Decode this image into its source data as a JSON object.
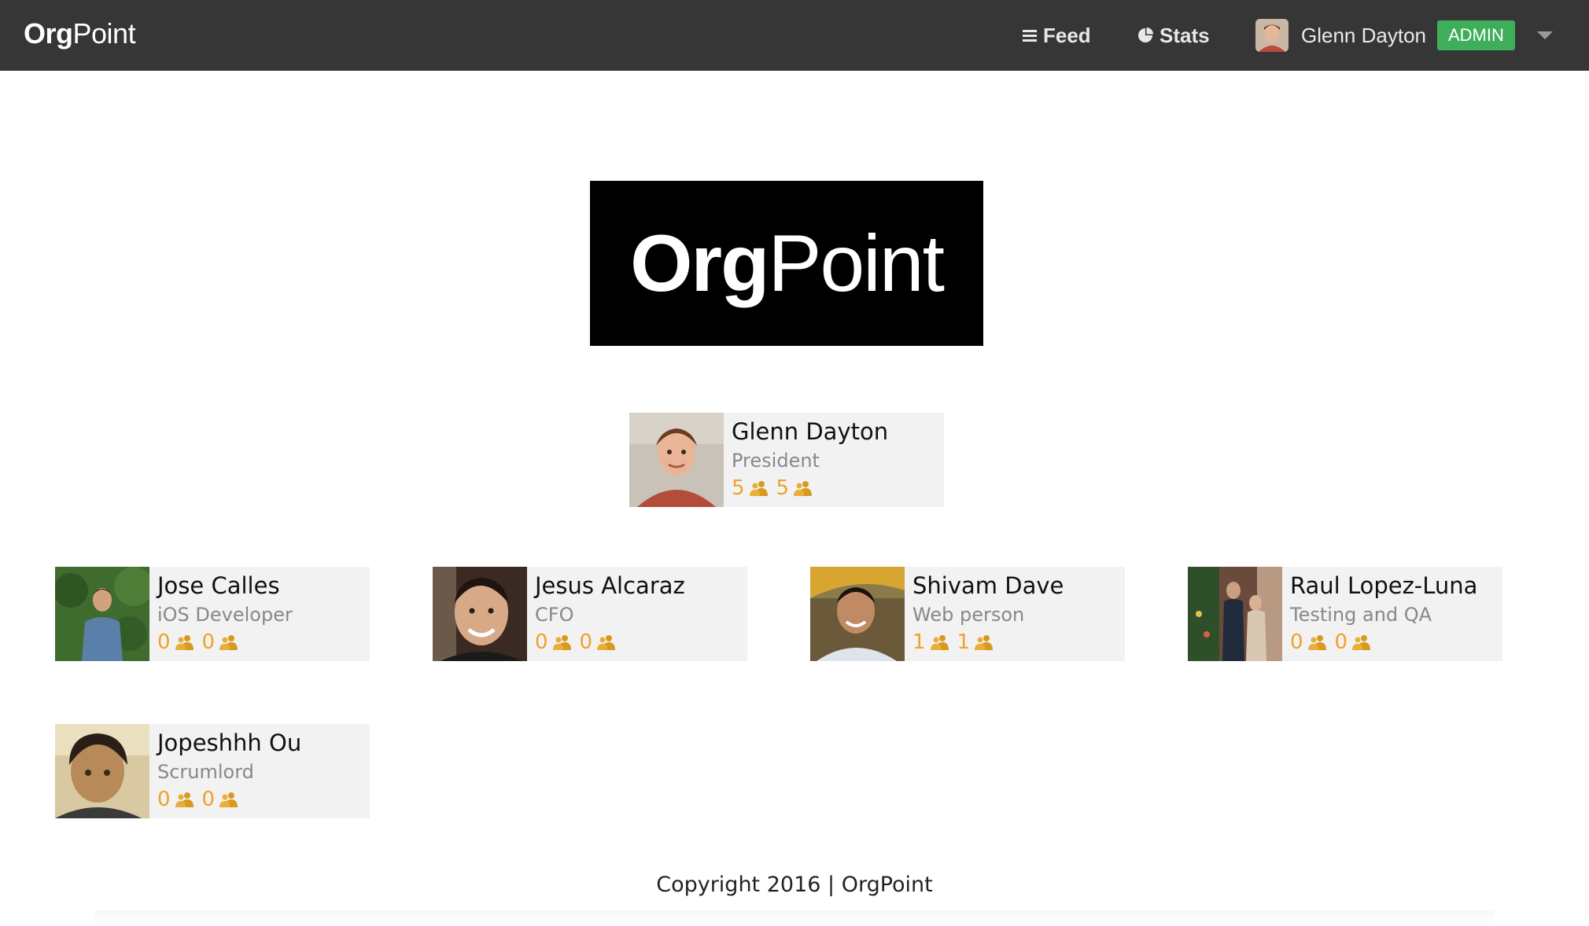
{
  "navbar": {
    "brand_bold": "Org",
    "brand_regular": "Point",
    "feed_label": "Feed",
    "stats_label": "Stats",
    "user_name": "Glenn Dayton",
    "admin_badge": "ADMIN",
    "icons": {
      "feed": "list-icon",
      "stats": "pie-chart-icon",
      "menu": "caret-down-icon"
    }
  },
  "logo": {
    "bold": "Org",
    "regular": "Point"
  },
  "people": [
    {
      "name": "Glenn Dayton",
      "role": "President",
      "count_a": "5",
      "count_b": "5"
    },
    {
      "name": "Jose Calles",
      "role": "iOS Developer",
      "count_a": "0",
      "count_b": "0"
    },
    {
      "name": "Jesus Alcaraz",
      "role": "CFO",
      "count_a": "0",
      "count_b": "0"
    },
    {
      "name": "Shivam Dave",
      "role": "Web person",
      "count_a": "1",
      "count_b": "1"
    },
    {
      "name": "Raul Lopez-Luna",
      "role": "Testing and QA",
      "count_a": "0",
      "count_b": "0"
    },
    {
      "name": "Jopeshhh Ou",
      "role": "Scrumlord",
      "count_a": "0",
      "count_b": "0"
    }
  ],
  "footer": {
    "text": "Copyright 2016 | OrgPoint"
  },
  "colors": {
    "navbar_bg": "#363636",
    "admin_badge": "#3fae5a",
    "count_color": "#f0a12a",
    "card_bg": "#f2f2f2"
  }
}
